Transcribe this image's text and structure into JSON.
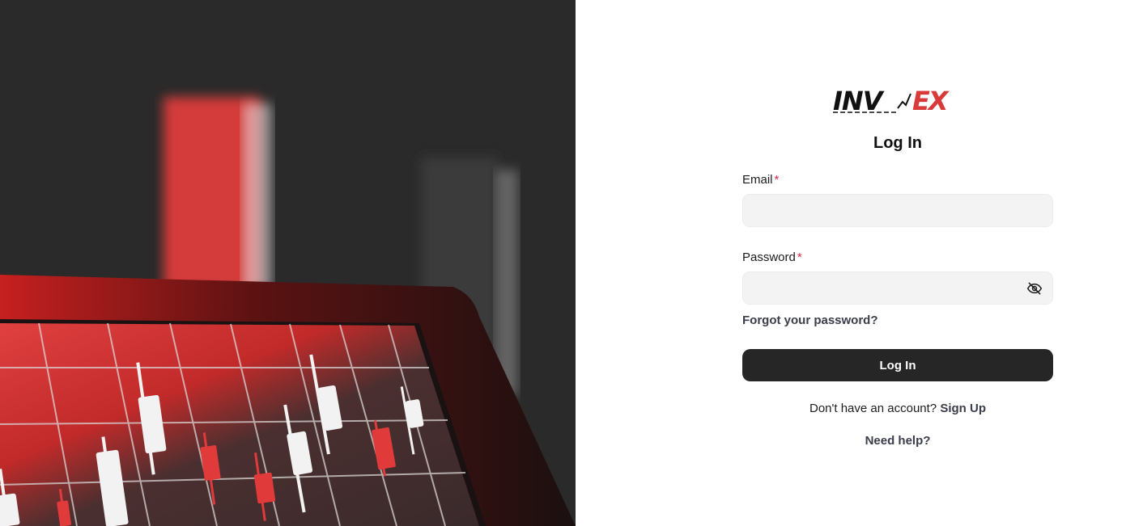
{
  "brand": {
    "logo_text_left": "INV",
    "logo_text_right": "EX",
    "accent_red": "#d83a3a",
    "accent_green": "#5f7a6e"
  },
  "login": {
    "heading": "Log In",
    "email_label": "Email",
    "password_label": "Password",
    "required_mark": "*",
    "email_value": "",
    "password_value": "",
    "forgot_link": "Forgot your password?",
    "submit_label": "Log In",
    "signup_prompt": "Don't have an account?",
    "signup_link": "Sign Up",
    "help_link": "Need help?"
  },
  "icons": {
    "password_toggle": "eye-off-icon"
  },
  "colors": {
    "button_bg": "#262626",
    "input_bg": "#f3f3f3",
    "required": "#d9264a",
    "hero_bg": "#2a2a2a"
  }
}
